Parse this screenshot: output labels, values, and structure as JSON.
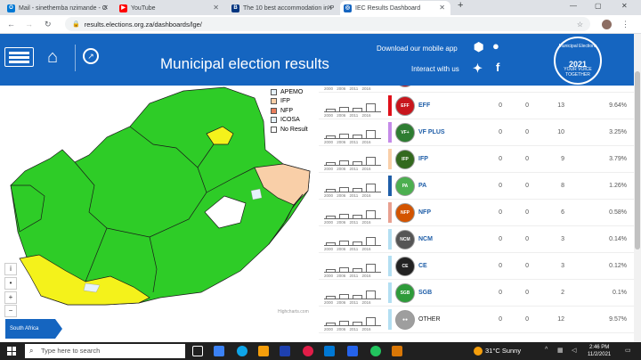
{
  "browser": {
    "tabs": [
      {
        "title": "Mail - sinethemba nzimande - O",
        "color": "#0078d4",
        "glyph": "O"
      },
      {
        "title": "YouTube",
        "color": "#ff0000",
        "glyph": "▶"
      },
      {
        "title": "The 10 best accommodation in P",
        "color": "#003580",
        "glyph": "B"
      },
      {
        "title": "IEC Results Dashboard",
        "color": "#1565c0",
        "glyph": "◎"
      }
    ],
    "url": "results.elections.org.za/dashboards/lge/"
  },
  "header": {
    "title": "Municipal election results",
    "download": "Download our mobile app",
    "interact": "Interact with us",
    "logo_top": "Municipal Elections",
    "logo_year": "2021",
    "logo_bottom": "YOUR VOICE TOGETHER"
  },
  "map": {
    "legend": [
      {
        "label": "APEMO",
        "color": "#e6f2fb"
      },
      {
        "label": "IFP",
        "color": "#f9cfa8"
      },
      {
        "label": "NFP",
        "color": "#e87d5c"
      },
      {
        "label": "ICOSA",
        "color": "#e6f2fb"
      },
      {
        "label": "No Result",
        "color": "#ffffff"
      }
    ],
    "credit": "Highcharts.com",
    "region": "South Africa",
    "colors": {
      "anc": "#2ecc27",
      "da": "#f4f21b",
      "ifp": "#f9cfa8"
    }
  },
  "results": {
    "years": "2000 2006 2011 2016",
    "rows": [
      {
        "party": "EFF",
        "c1": "0",
        "c2": "0",
        "seats": "13",
        "pct": "9.64%",
        "color": "#e0101a",
        "logo": "#c8161d",
        "logo_text": "EFF",
        "plain": false
      },
      {
        "party": "VF PLUS",
        "c1": "0",
        "c2": "0",
        "seats": "10",
        "pct": "3.25%",
        "color": "#c58be8",
        "logo": "#2e7d32",
        "logo_text": "VF+",
        "plain": false
      },
      {
        "party": "IFP",
        "c1": "0",
        "c2": "0",
        "seats": "9",
        "pct": "3.79%",
        "color": "#f9cfa8",
        "logo": "#33691e",
        "logo_text": "IFP",
        "plain": false
      },
      {
        "party": "PA",
        "c1": "0",
        "c2": "0",
        "seats": "8",
        "pct": "1.26%",
        "color": "#1f5ea8",
        "logo": "#4caf50",
        "logo_text": "PA",
        "plain": false
      },
      {
        "party": "NFP",
        "c1": "0",
        "c2": "0",
        "seats": "6",
        "pct": "0.58%",
        "color": "#e8a090",
        "logo": "#d35400",
        "logo_text": "NFP",
        "plain": false
      },
      {
        "party": "NCM",
        "c1": "0",
        "c2": "0",
        "seats": "3",
        "pct": "0.14%",
        "color": "#b3dff2",
        "logo": "#555555",
        "logo_text": "NCM",
        "plain": false
      },
      {
        "party": "CE",
        "c1": "0",
        "c2": "0",
        "seats": "3",
        "pct": "0.12%",
        "color": "#b3dff2",
        "logo": "#222222",
        "logo_text": "CE",
        "plain": false
      },
      {
        "party": "SGB",
        "c1": "0",
        "c2": "0",
        "seats": "2",
        "pct": "0.1%",
        "color": "#b3dff2",
        "logo": "#2e9b3a",
        "logo_text": "SGB",
        "plain": false
      },
      {
        "party": "OTHER",
        "c1": "0",
        "c2": "0",
        "seats": "12",
        "pct": "9.57%",
        "color": "#b3dff2",
        "logo": "#9e9e9e",
        "logo_text": "●●",
        "plain": true
      }
    ]
  },
  "taskbar": {
    "search": "Type here to search",
    "weather": "31°C  Sunny",
    "time": "2:46 PM",
    "date": "11/2/2021"
  }
}
